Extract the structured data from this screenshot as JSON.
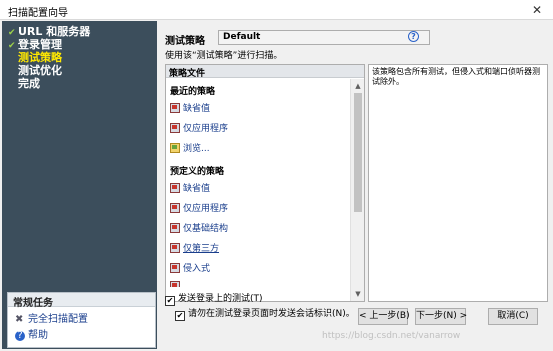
{
  "window": {
    "title": "扫描配置向导",
    "close_glyph": "✕"
  },
  "steps": [
    {
      "label": "URL 和服务器",
      "done": true,
      "active": false
    },
    {
      "label": "登录管理",
      "done": true,
      "active": false
    },
    {
      "label": "测试策略",
      "done": false,
      "active": true
    },
    {
      "label": "测试优化",
      "done": false,
      "active": false
    },
    {
      "label": "完成",
      "done": false,
      "active": false
    }
  ],
  "common_tasks": {
    "header": "常规任务",
    "items": [
      {
        "label": "完全扫描配置",
        "icon": "wrench-icon"
      },
      {
        "label": "帮助",
        "icon": "help-icon"
      }
    ]
  },
  "policy": {
    "label": "测试策略",
    "value": "Default",
    "usage": "使用该“测试策略”进行扫描。"
  },
  "policy_files": {
    "header": "策略文件",
    "recent_title": "最近的策略",
    "recent": [
      {
        "label": "缺省值",
        "kind": "policy"
      },
      {
        "label": "仅应用程序",
        "kind": "policy"
      },
      {
        "label": "浏览...",
        "kind": "browse"
      }
    ],
    "predefined_title": "预定义的策略",
    "predefined": [
      {
        "label": "缺省值",
        "kind": "policy"
      },
      {
        "label": "仅应用程序",
        "kind": "policy"
      },
      {
        "label": "仅基础结构",
        "kind": "policy"
      },
      {
        "label": "仅第三方",
        "kind": "policy",
        "selected": true
      },
      {
        "label": "侵入式",
        "kind": "policy"
      },
      {
        "label": "",
        "kind": "policy"
      }
    ]
  },
  "description": "该策略包含所有测试，但侵入式和端口侦听器测试除外。",
  "options": {
    "send_login_tests": {
      "label": "发送登录上的测试(T)",
      "checked": true
    },
    "no_session_id": {
      "label": "请勿在测试登录页面时发送会话标识(N)。",
      "checked": true
    }
  },
  "buttons": {
    "back": "< 上一步(B)",
    "next": "下一步(N) >",
    "cancel": "取消(C)"
  },
  "watermark": "https://blog.csdn.net/vanarrow"
}
